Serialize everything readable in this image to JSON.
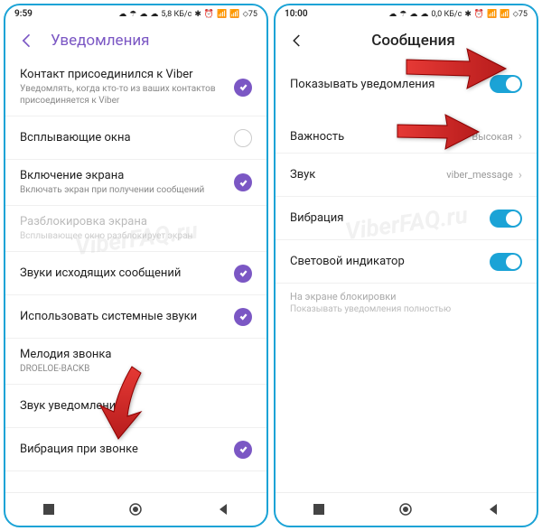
{
  "watermark": "ViberFAQ.ru",
  "left": {
    "statusbar": {
      "time": "9:59",
      "net": "5,8 КБ/с",
      "battery": "75"
    },
    "header": {
      "title": "Уведомления"
    },
    "rows": [
      {
        "title": "Контакт присоединился к Viber",
        "sub": "Уведомлять, когда кто-то из ваших контактов присоединяется к Viber",
        "ctrl": "check"
      },
      {
        "title": "Всплывающие окна",
        "ctrl": "empty"
      },
      {
        "title": "Включение экрана",
        "sub": "Включать экран при получении сообщений",
        "ctrl": "check"
      },
      {
        "title": "Разблокировка экрана",
        "sub": "Всплывающее окно разблокирует экран",
        "ctrl": "none",
        "disabled": true
      },
      {
        "title": "Звуки исходящих сообщений",
        "ctrl": "check"
      },
      {
        "title": "Использовать системные звуки",
        "ctrl": "check"
      },
      {
        "title": "Мелодия звонка",
        "sub": "DROELOE-BACKB",
        "ctrl": "none"
      },
      {
        "title": "Звук уведомления",
        "ctrl": "none"
      },
      {
        "title": "Вибрация при звонке",
        "ctrl": "check"
      }
    ]
  },
  "right": {
    "statusbar": {
      "time": "10:00",
      "net": "0,0 КБ/с",
      "battery": "75"
    },
    "header": {
      "title": "Сообщения"
    },
    "rows": [
      {
        "title": "Показывать уведомления",
        "ctrl": "toggle"
      },
      {
        "title": "Важность",
        "value": "Высокая",
        "ctrl": "nav"
      },
      {
        "title": "Звук",
        "value": "viber_message",
        "ctrl": "nav"
      },
      {
        "title": "Вибрация",
        "ctrl": "toggle"
      },
      {
        "title": "Световой индикатор",
        "ctrl": "toggle"
      }
    ],
    "section": {
      "label": "На экране блокировки",
      "sub": "Показывать уведомления полностью"
    }
  }
}
